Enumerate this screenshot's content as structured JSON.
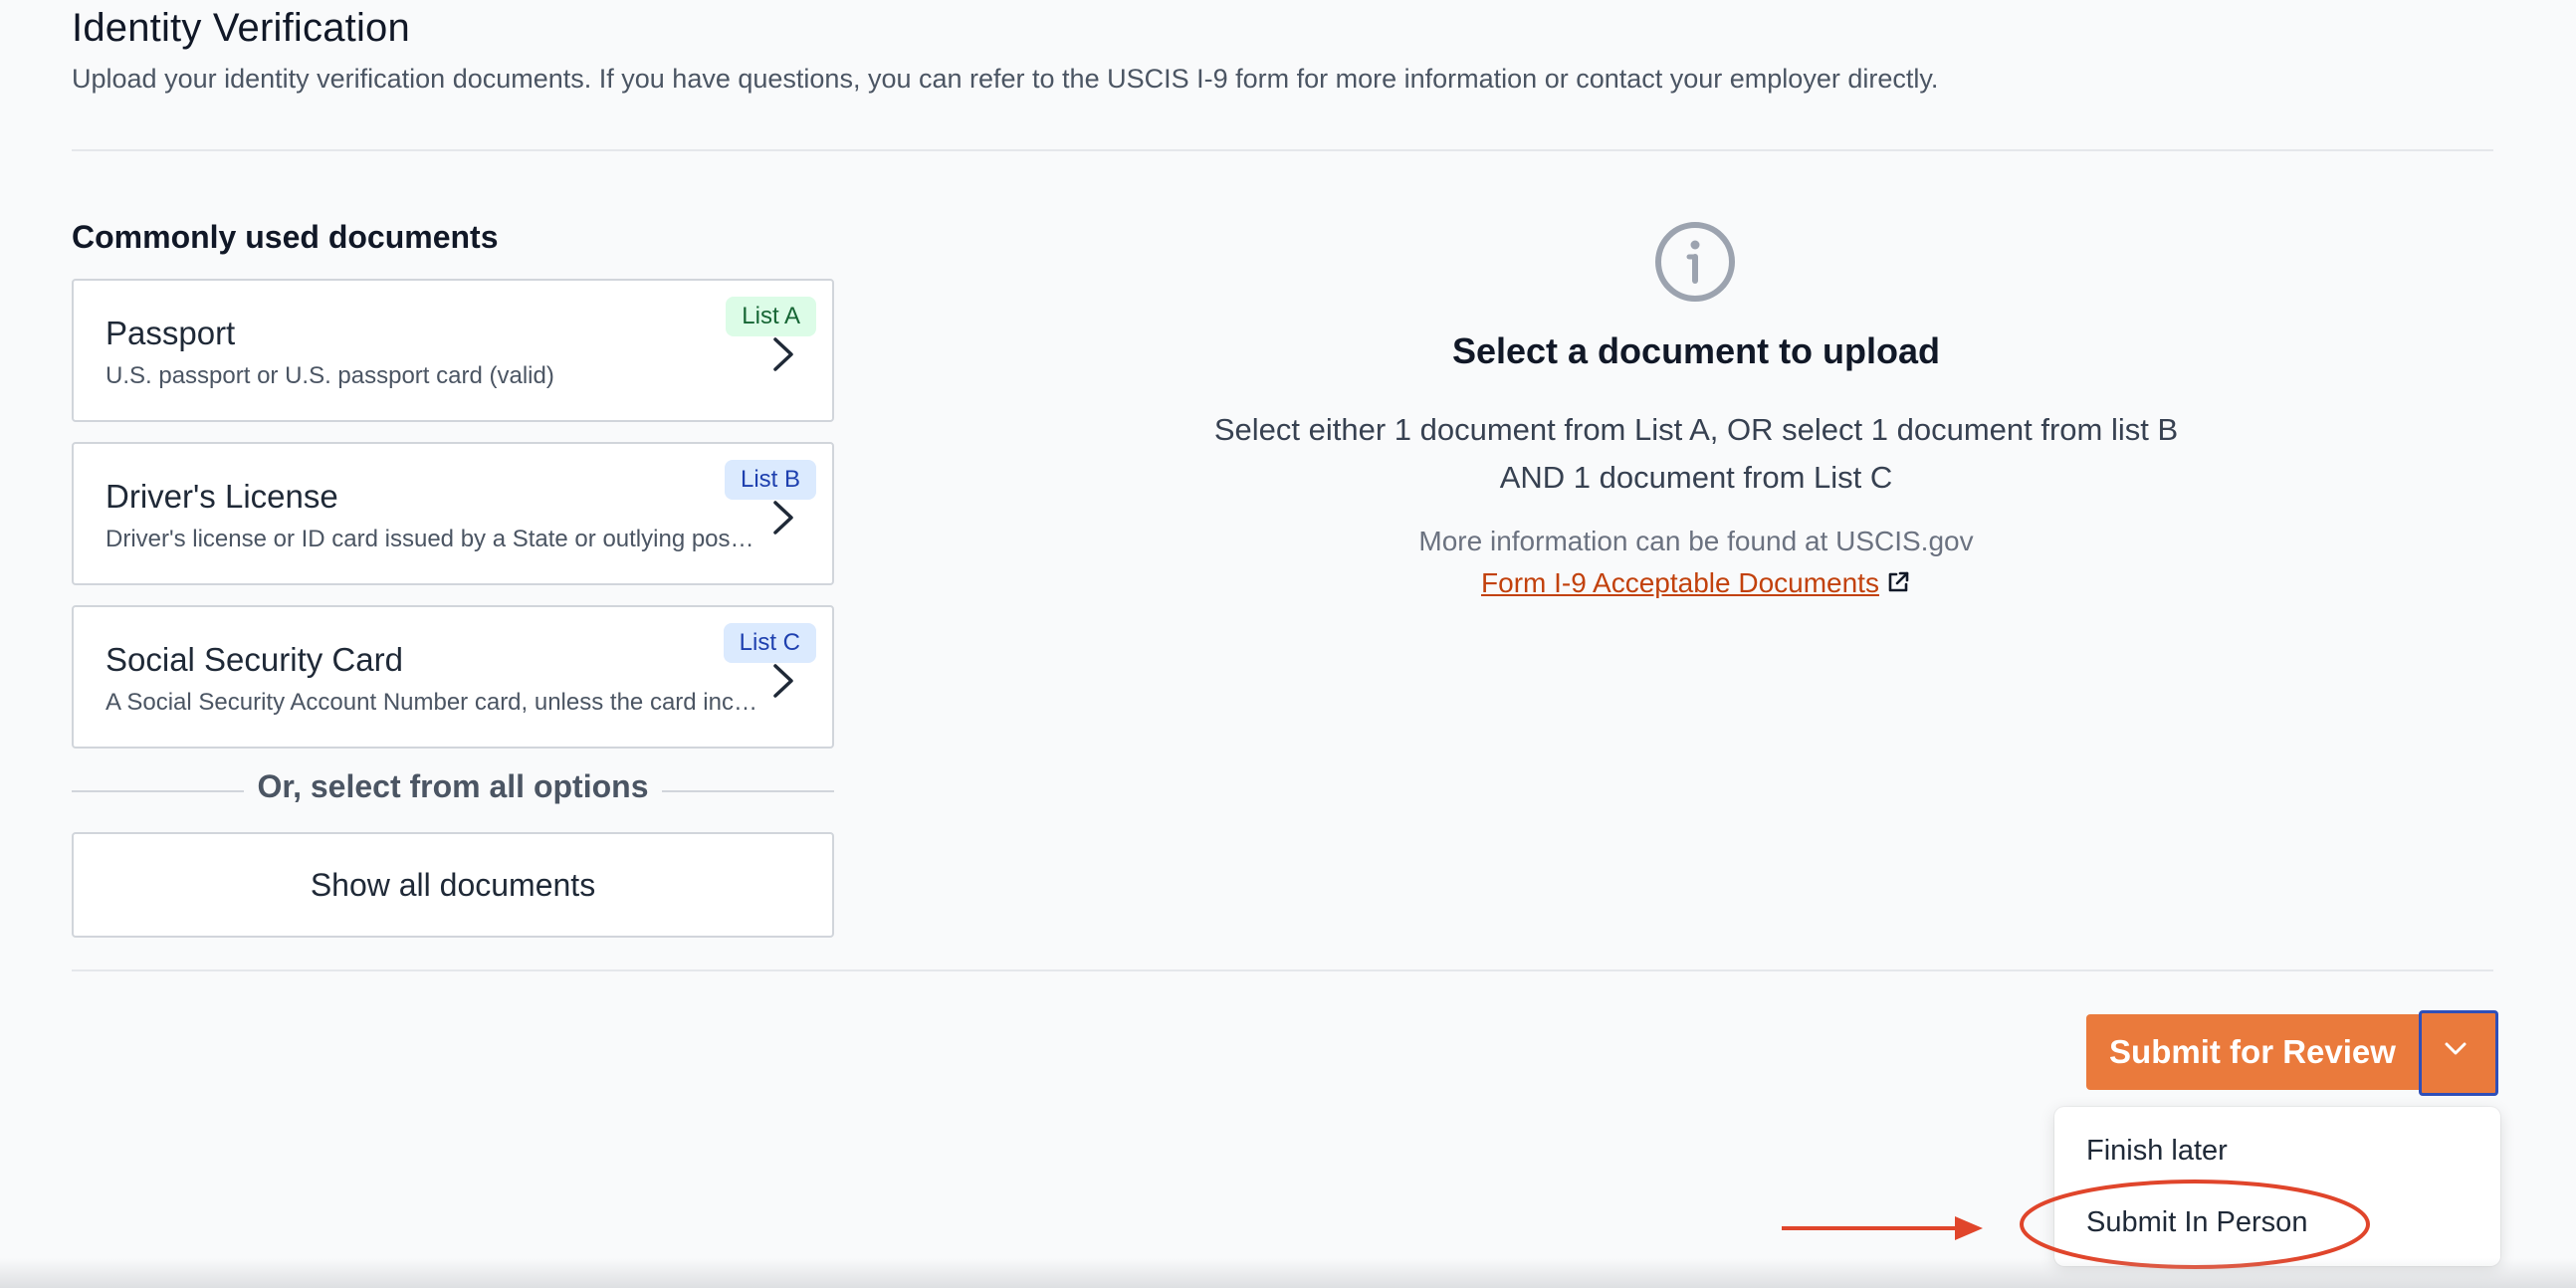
{
  "header": {
    "title": "Identity Verification",
    "description": "Upload your identity verification documents. If you have questions, you can refer to the USCIS I-9 form for more information or contact your employer directly."
  },
  "documents": {
    "section_title": "Commonly used documents",
    "items": [
      {
        "title": "Passport",
        "desc": "U.S. passport or U.S. passport card (valid)",
        "badge": "List A"
      },
      {
        "title": "Driver's License",
        "desc": "Driver's license or ID card issued by a State or outlying possession of the United States",
        "badge": "List B"
      },
      {
        "title": "Social Security Card",
        "desc": "A Social Security Account Number card, unless the card includes one of the following restrictions",
        "badge": "List C"
      }
    ],
    "or_text": "Or, select from all options",
    "show_all_label": "Show all documents"
  },
  "upload_panel": {
    "icon": "info-icon",
    "title": "Select a document to upload",
    "line1": "Select either 1 document from List A, OR select 1 document from list B",
    "line2": "AND 1 document from List C",
    "more_info": "More information can be found at USCIS.gov",
    "link_text": "Form I-9 Acceptable Documents"
  },
  "actions": {
    "submit_label": "Submit for Review",
    "menu_items": [
      "Finish later",
      "Submit In Person"
    ]
  },
  "colors": {
    "accent": "#ea7a3c",
    "link": "#c2410c",
    "annotation": "#e0452b",
    "toggle_focus": "#2f4fb8"
  }
}
